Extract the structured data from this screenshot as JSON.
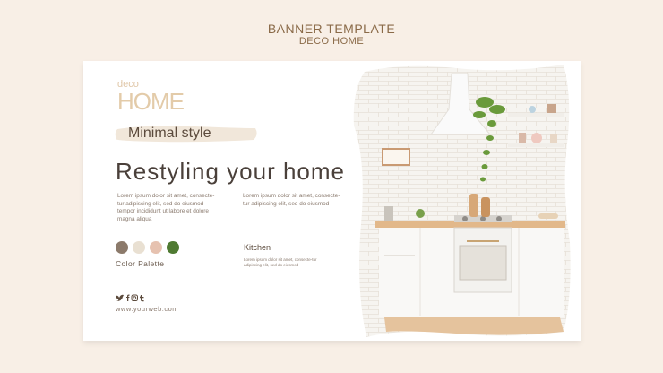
{
  "header": {
    "line1": "BANNER TEMPLATE",
    "line2": "DECO HOME"
  },
  "banner": {
    "logo_small": "deco",
    "logo_big": "HOME",
    "tagline": "Minimal style",
    "headline": "Restyling your home",
    "paragraph_1": "Lorem ipsum dolor sit amet, consecte-tur adipiscing elit, sed do eiusmod tempor incididunt ut labore et dolore magna aliqua",
    "paragraph_2": "Lorem ipsum dolor sit amet, consecte-tur adipiscing elit, sed do eiusmod",
    "palette_label": "Color Palette",
    "palette_colors": [
      "#8c7a6b",
      "#e9e0d2",
      "#e6c2b0",
      "#4f7a32"
    ],
    "kitchen_label": "Kitchen",
    "kitchen_text": "Lorem ipsum dolor sit amet, consecte-tur adipiscing elit, sed do eiusmod",
    "social_icons": "twitter-facebook-instagram-tumblr",
    "website": "www.yourweb.com"
  },
  "colors": {
    "background": "#f8efe6",
    "header_text": "#8a6a48",
    "logo": "#e3cba9",
    "text_dark": "#4a403a"
  }
}
